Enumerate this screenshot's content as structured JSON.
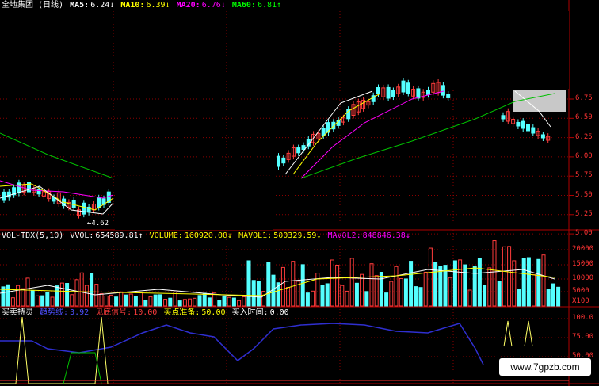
{
  "price_panel": {
    "title": "全地集团 (日线)",
    "ma5_label": "MA5:",
    "ma5_value": "6.24↓",
    "ma10_label": "MA10:",
    "ma10_value": "6.39↓",
    "ma20_label": "MA20:",
    "ma20_value": "6.76↓",
    "ma60_label": "MA60:",
    "ma60_value": "6.81↑",
    "low_annotation": "4.62",
    "y_ticks": [
      "6.75",
      "6.50",
      "6.25",
      "6.00",
      "5.75",
      "5.50",
      "5.25",
      "5.00"
    ]
  },
  "volume_panel": {
    "title": "VOL-TDX(5,10)",
    "vvol_label": "VVOL:",
    "vvol_value": "654589.81↑",
    "volume_label": "VOLUME:",
    "volume_value": "160920.00↓",
    "mavol1_label": "MAVOL1:",
    "mavol1_value": "500329.59↓",
    "mavol2_label": "MAVOL2:",
    "mavol2_value": "848846.38↓",
    "y_ticks": [
      "20000",
      "15000",
      "10000",
      "5000",
      "X100"
    ]
  },
  "indicator_panel": {
    "title": "买卖持灵",
    "field1_label": "趋势线:",
    "field1_value": "3.92",
    "field2_label": "见底信号:",
    "field2_value": "10.00",
    "field3_label": "买点准备:",
    "field3_value": "50.00",
    "field4_label": "买入时间:",
    "field4_value": "0.00",
    "y_ticks": [
      "100.0",
      "75.00",
      "50.00"
    ]
  },
  "watermark": "www.7gpzb.com",
  "colors": {
    "up": "#ff3c3c",
    "down": "#54ffff",
    "ma5": "#ffffff",
    "ma10": "#ffff00",
    "ma20": "#ff00ff",
    "ma60": "#00c000",
    "grid": "#8b0000"
  }
}
